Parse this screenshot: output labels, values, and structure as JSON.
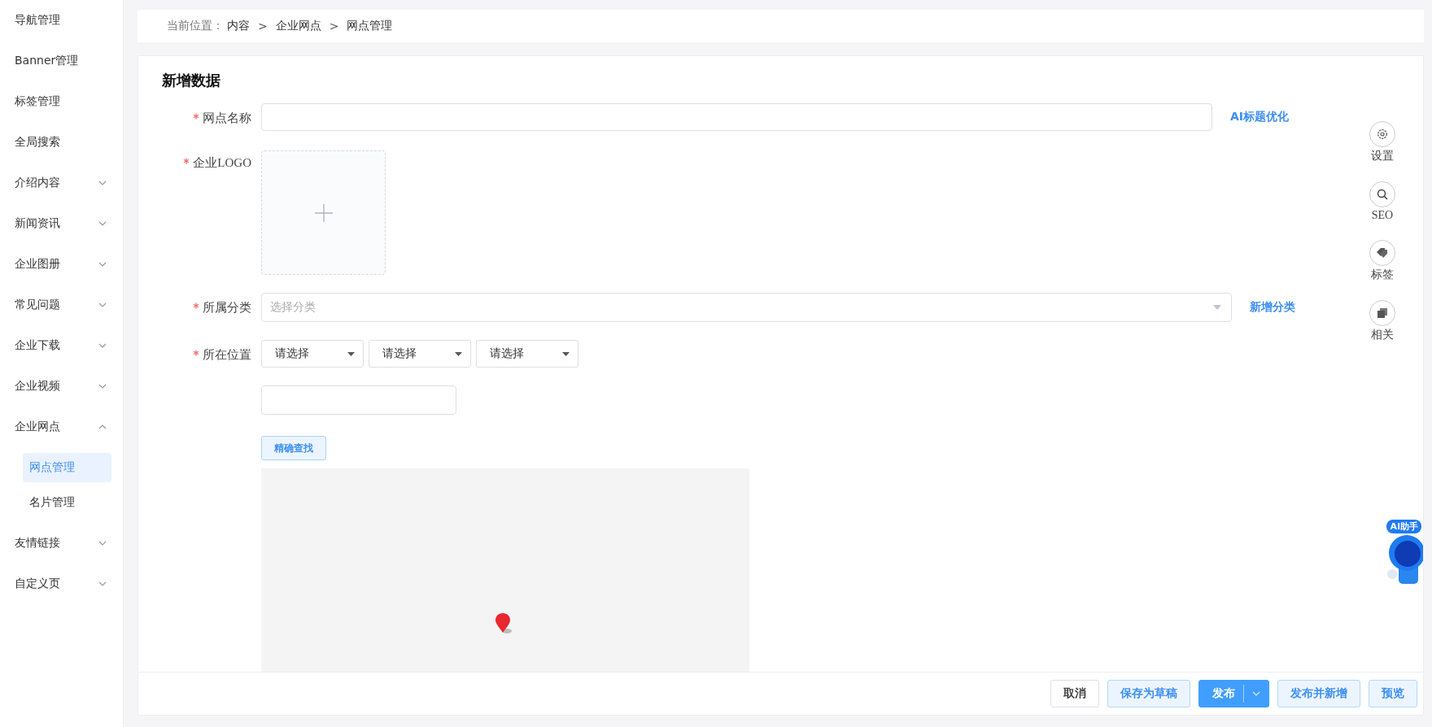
{
  "sidebar": {
    "items": [
      {
        "label": "导航管理",
        "kind": "link"
      },
      {
        "label": "Banner管理",
        "kind": "link"
      },
      {
        "label": "标签管理",
        "kind": "link"
      },
      {
        "label": "全局搜索",
        "kind": "link"
      },
      {
        "label": "介绍内容",
        "kind": "group",
        "expanded": false
      },
      {
        "label": "新闻资讯",
        "kind": "group",
        "expanded": false
      },
      {
        "label": "企业图册",
        "kind": "group",
        "expanded": false
      },
      {
        "label": "常见问题",
        "kind": "group",
        "expanded": false
      },
      {
        "label": "企业下载",
        "kind": "group",
        "expanded": false
      },
      {
        "label": "企业视频",
        "kind": "group",
        "expanded": false
      },
      {
        "label": "企业网点",
        "kind": "group",
        "expanded": true,
        "children": [
          {
            "label": "网点管理",
            "selected": true
          },
          {
            "label": "名片管理",
            "selected": false
          }
        ]
      },
      {
        "label": "友情链接",
        "kind": "group",
        "expanded": false
      },
      {
        "label": "自定义页",
        "kind": "group",
        "expanded": false
      }
    ]
  },
  "breadcrumb": {
    "prefix": "当前位置：",
    "items": [
      "内容",
      "企业网点",
      "网点管理"
    ],
    "separator": ">"
  },
  "form": {
    "title": "新增数据",
    "fields": [
      {
        "kind": "text",
        "label": "网点名称",
        "required": true,
        "link": "AI标题优化"
      },
      {
        "kind": "upload",
        "label": "企业LOGO",
        "required": true
      },
      {
        "kind": "select",
        "label": "所属分类",
        "required": true,
        "placeholder": "选择分类",
        "link": "新增分类"
      },
      {
        "kind": "location",
        "label": "所在位置",
        "required": true,
        "selects": [
          "请选择",
          "请选择",
          "请选择"
        ],
        "search_button": "精确查找"
      }
    ]
  },
  "side_tools": [
    {
      "label": "设置",
      "kind": "gear"
    },
    {
      "label": "SEO",
      "kind": "search"
    },
    {
      "label": "标签",
      "kind": "tag"
    },
    {
      "label": "相关",
      "kind": "stack"
    }
  ],
  "assistant": {
    "label": "AI助手"
  },
  "footer": {
    "buttons": [
      {
        "label": "取消",
        "kind": "default"
      },
      {
        "label": "保存为草稿",
        "kind": "light"
      },
      {
        "label": "发布",
        "kind": "primary-split"
      },
      {
        "label": "发布并新增",
        "kind": "light"
      },
      {
        "label": "预览",
        "kind": "light"
      }
    ]
  }
}
